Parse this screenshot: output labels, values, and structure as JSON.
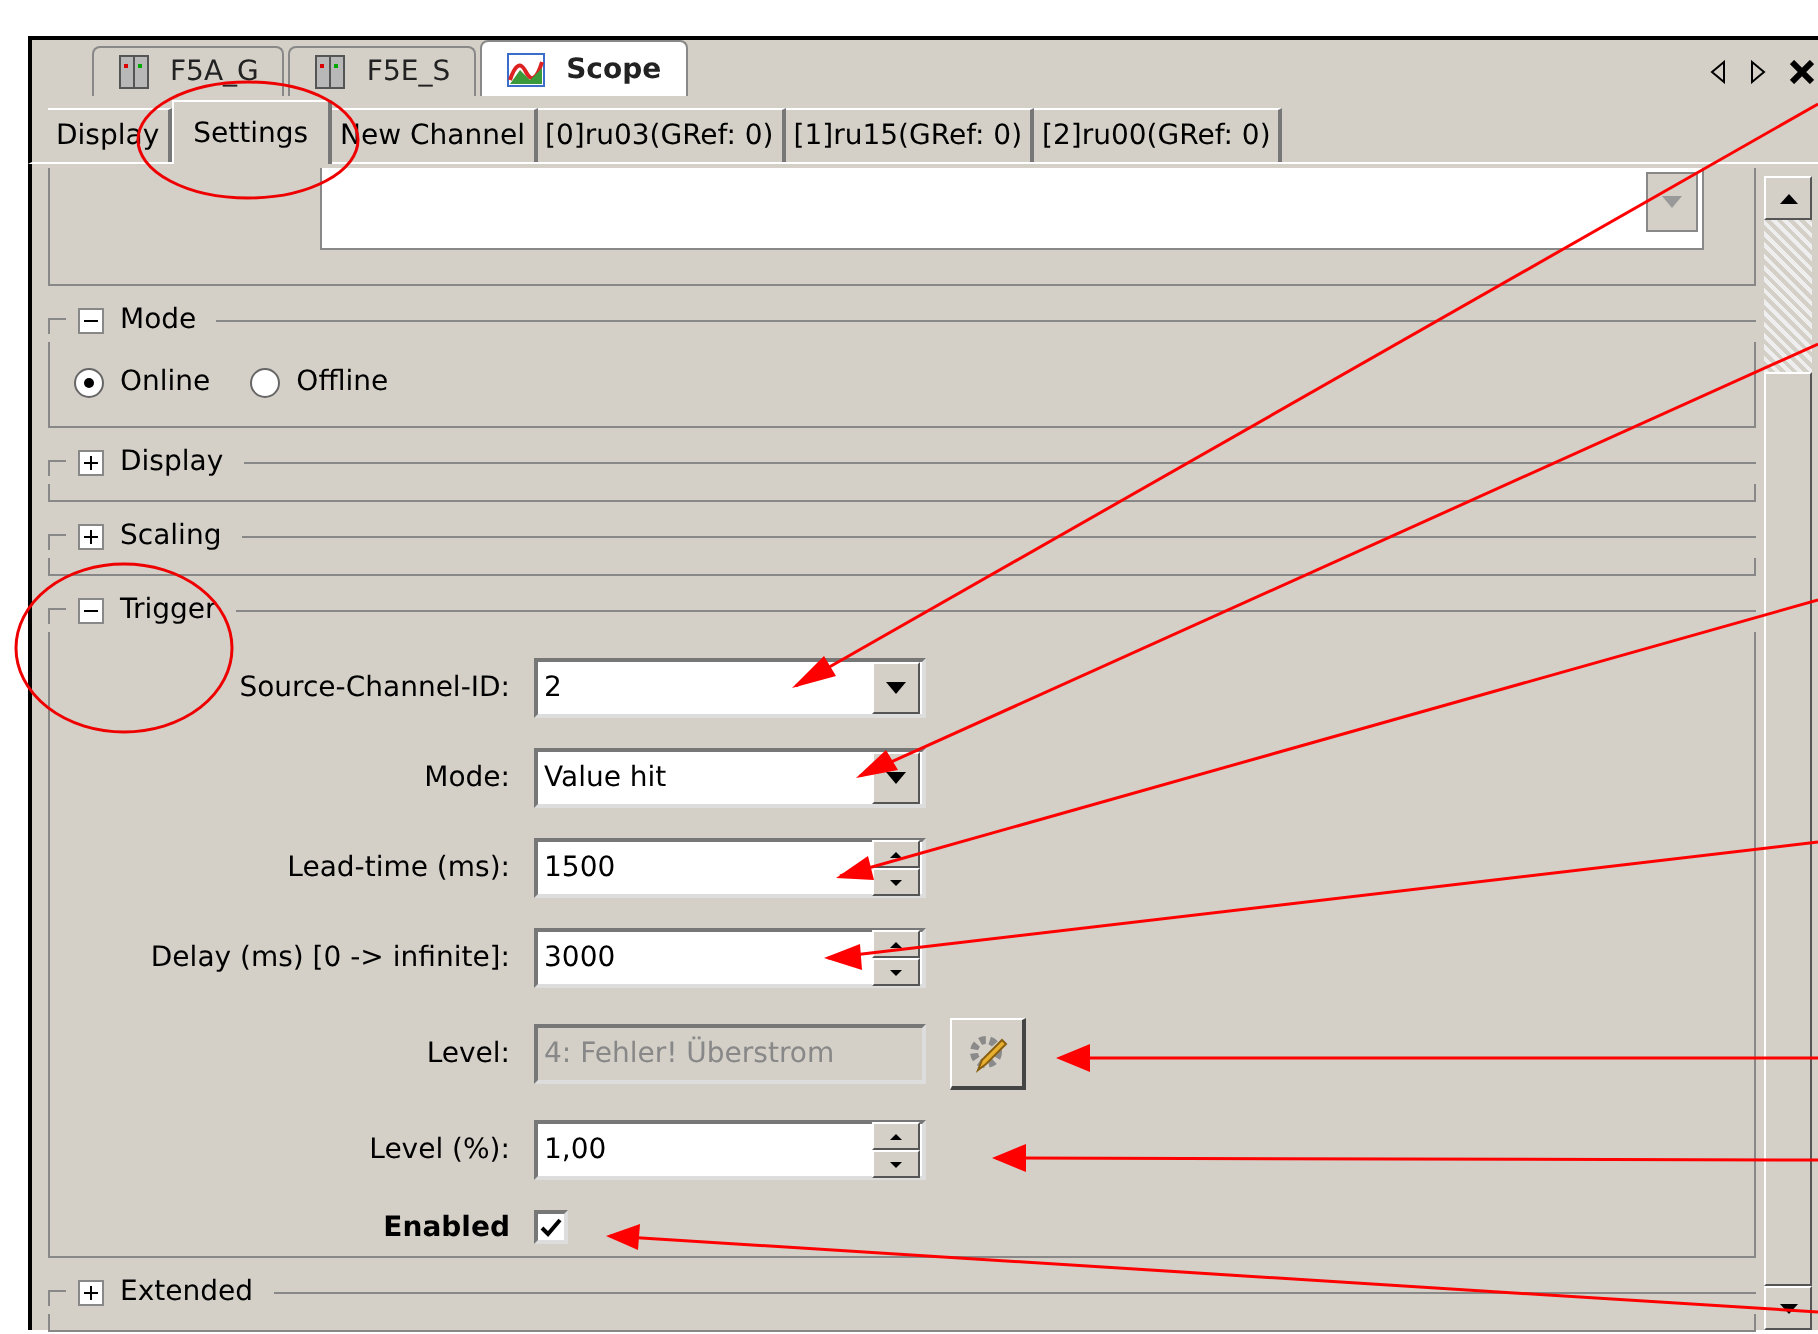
{
  "doc_tabs": [
    {
      "label": "F5A_G",
      "kind": "device",
      "selected": false
    },
    {
      "label": "F5E_S",
      "kind": "device",
      "selected": false
    },
    {
      "label": "Scope",
      "kind": "scope",
      "selected": true
    }
  ],
  "sub_tabs": [
    {
      "label": "Display",
      "selected": false
    },
    {
      "label": "Settings",
      "selected": true
    },
    {
      "label": "New Channel",
      "selected": false
    },
    {
      "label": "[0]ru03(GRef: 0)",
      "selected": false
    },
    {
      "label": "[1]ru15(GRef: 0)",
      "selected": false
    },
    {
      "label": "[2]ru00(GRef: 0)",
      "selected": false
    }
  ],
  "sections": [
    {
      "title": "Mode",
      "expanded": true,
      "kind": "radios",
      "options": [
        {
          "label": "Online",
          "selected": true
        },
        {
          "label": "Offline",
          "selected": false
        }
      ]
    },
    {
      "title": "Display",
      "expanded": false
    },
    {
      "title": "Scaling",
      "expanded": false
    },
    {
      "title": "Trigger",
      "expanded": true,
      "kind": "form",
      "fields": [
        {
          "label": "Source-Channel-ID:",
          "kind": "dropdown",
          "value": "2"
        },
        {
          "label": "Mode:",
          "kind": "dropdown",
          "value": "Value hit"
        },
        {
          "label": "Lead-time (ms):",
          "kind": "spinner",
          "value": "1500"
        },
        {
          "label": "Delay (ms) [0 -> infinite]:",
          "kind": "spinner",
          "value": "3000"
        },
        {
          "label": "Level:",
          "kind": "picker",
          "value": "4: Fehler! Überstrom",
          "disabled": true
        },
        {
          "label": "Level (%):",
          "kind": "spinner",
          "value": "1,00"
        },
        {
          "label": "Enabled",
          "kind": "checkbox",
          "checked": true
        }
      ]
    },
    {
      "title": "Extended",
      "expanded": false
    }
  ]
}
